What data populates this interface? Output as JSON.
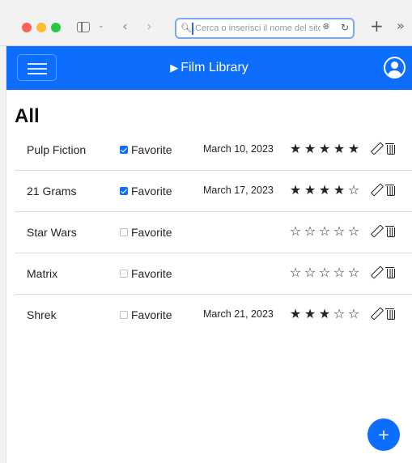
{
  "browser": {
    "url_placeholder": "Cerca o inserisci il nome del sito web",
    "search_icon": "magnifier-icon",
    "translate_icon": "translate-icon",
    "reload_icon": "reload-icon",
    "back_glyph": "‹",
    "forward_glyph": "›",
    "chevron_glyph": "⌄",
    "newtab_glyph": "+",
    "overflow_glyph": "»"
  },
  "navbar": {
    "brand": "Film Library",
    "brand_icon": "▶",
    "color": "#0d6efd"
  },
  "filter": {
    "title": "All"
  },
  "films": [
    {
      "title": "Pulp Fiction",
      "favorite": true,
      "favorite_label": "Favorite",
      "watch_date": "March 10, 2023",
      "rating": 5
    },
    {
      "title": "21 Grams",
      "favorite": true,
      "favorite_label": "Favorite",
      "watch_date": "March 17, 2023",
      "rating": 4
    },
    {
      "title": "Star Wars",
      "favorite": false,
      "favorite_label": "Favorite",
      "watch_date": "",
      "rating": 0
    },
    {
      "title": "Matrix",
      "favorite": false,
      "favorite_label": "Favorite",
      "watch_date": "",
      "rating": 0
    },
    {
      "title": "Shrek",
      "favorite": false,
      "favorite_label": "Favorite",
      "watch_date": "March 21, 2023",
      "rating": 3
    }
  ],
  "rating_max": 5,
  "star_filled_glyph": "★",
  "star_empty_glyph": "☆",
  "fab": {
    "label": "+"
  }
}
